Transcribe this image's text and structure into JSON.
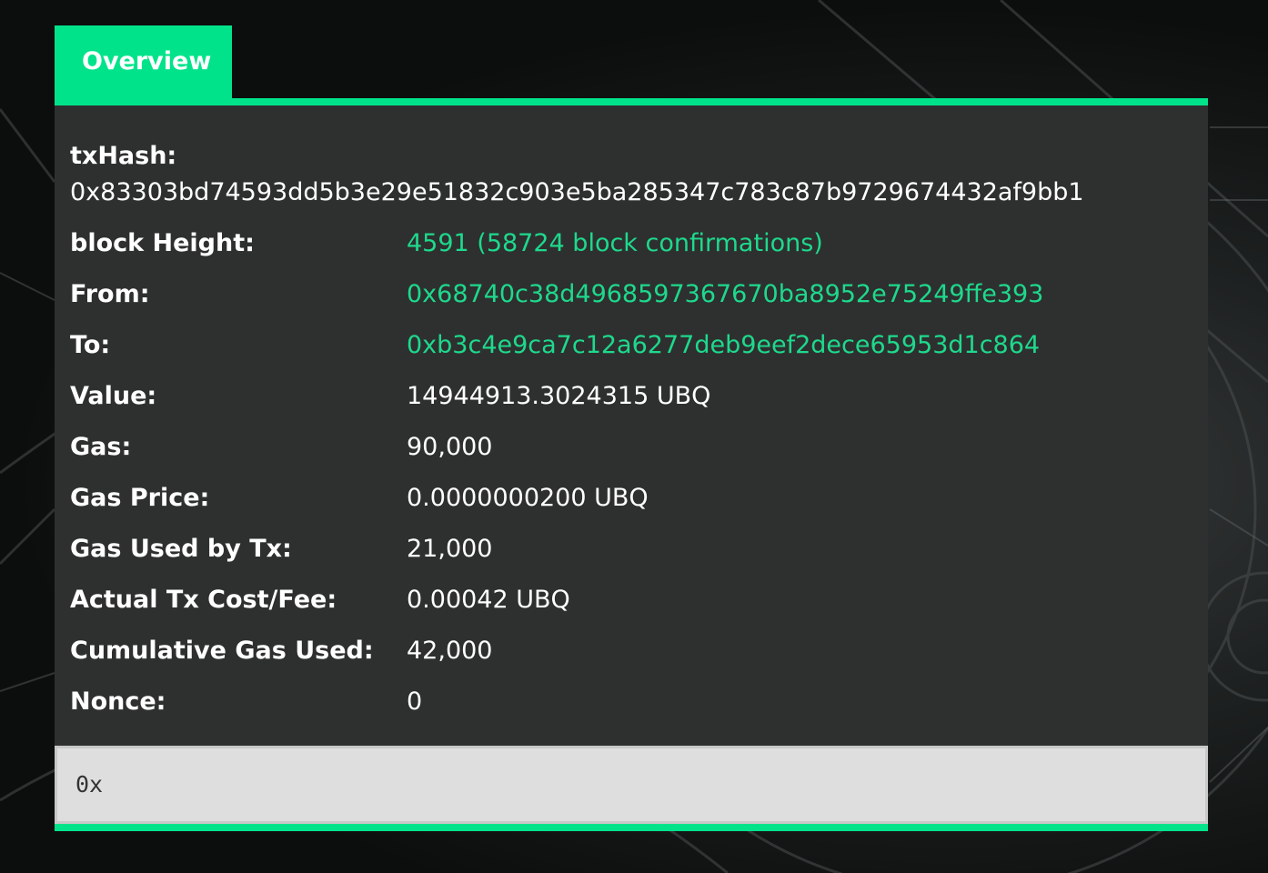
{
  "tab": {
    "label": "Overview"
  },
  "tx": {
    "hash_label": "txHash:",
    "hash_value": "0x83303bd74593dd5b3e29e51832c903e5ba285347c783c87b9729674432af9bb1",
    "rows": [
      {
        "label": "block Height:",
        "value": "4591 (58724 block confirmations)",
        "link": true
      },
      {
        "label": "From:",
        "value": "0x68740c38d4968597367670ba8952e75249ffe393",
        "link": true
      },
      {
        "label": "To:",
        "value": "0xb3c4e9ca7c12a6277deb9eef2dece65953d1c864",
        "link": true
      },
      {
        "label": "Value:",
        "value": "14944913.3024315 UBQ",
        "link": false
      },
      {
        "label": "Gas:",
        "value": "90,000",
        "link": false
      },
      {
        "label": "Gas Price:",
        "value": "0.0000000200 UBQ",
        "link": false
      },
      {
        "label": "Gas Used by Tx:",
        "value": "21,000",
        "link": false
      },
      {
        "label": "Actual Tx Cost/Fee:",
        "value": "0.00042 UBQ",
        "link": false
      },
      {
        "label": "Cumulative Gas Used:",
        "value": "42,000",
        "link": false
      },
      {
        "label": "Nonce:",
        "value": "0",
        "link": false
      }
    ],
    "input_data": "0x"
  },
  "colors": {
    "accent": "#00e38a",
    "link": "#1ed98c",
    "panel": "#2e3030"
  }
}
